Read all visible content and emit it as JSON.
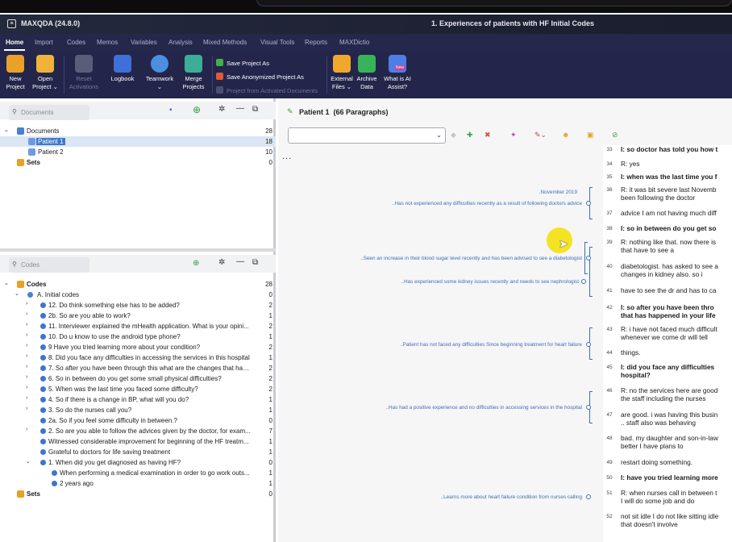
{
  "window": {
    "app_title": "MAXQDA (24.8.0)",
    "doc_title": "1. Experiences of patients with HF Initial Codes"
  },
  "menu": [
    "Home",
    "Import",
    "Codes",
    "Memos",
    "Variables",
    "Analysis",
    "Mixed Methods",
    "Visual Tools",
    "Reports",
    "MAXDictio"
  ],
  "ribbon": {
    "new_project": [
      "New",
      "Project"
    ],
    "open_project": [
      "Open",
      "Project ⌄"
    ],
    "reset_activations": [
      "Reset",
      "Activations"
    ],
    "logbook": "Logbook",
    "teamwork": [
      "Teamwork",
      "⌄"
    ],
    "merge_projects": [
      "Merge",
      "Projects"
    ],
    "save_project_as": "Save Project As",
    "save_anonymized": "Save Anonymized Project As",
    "project_from_activated": "Project from Activated Documents",
    "external_files": [
      "External",
      "Files ⌄"
    ],
    "archive_data": [
      "Archive",
      "Data"
    ],
    "ai_assist": [
      "What is AI",
      "Assist?"
    ],
    "ai_badge": "New"
  },
  "documents": {
    "search_placeholder": "Documents",
    "root": {
      "label": "Documents",
      "count": "28"
    },
    "items": [
      {
        "label": "Patient 1",
        "count": "18"
      },
      {
        "label": "Patient 2",
        "count": "10"
      }
    ],
    "sets": {
      "label": "Sets",
      "count": "0"
    }
  },
  "codes": {
    "search_placeholder": "Codes",
    "root": {
      "label": "Codes",
      "count": "28"
    },
    "items": [
      {
        "label": "A. Initial codes",
        "count": "0",
        "level": 1,
        "chev": "⌄"
      },
      {
        "label": "12. Do think something else has to be added?",
        "count": "2",
        "level": 2,
        "chev": "›"
      },
      {
        "label": "2b. So are you able to work?",
        "count": "1",
        "level": 2,
        "chev": "›"
      },
      {
        "label": "11. Interviewer explained the mHealth application.  What is your opini...",
        "count": "2",
        "level": 2,
        "chev": "›"
      },
      {
        "label": "10. Do u know to use the android type phone?",
        "count": "1",
        "level": 2,
        "chev": "›"
      },
      {
        "label": "9 Have you tried learning more about your condition?",
        "count": "2",
        "level": 2,
        "chev": "›"
      },
      {
        "label": "8. Did you face any difficulties in accessing the services in this hospital",
        "count": "1",
        "level": 2,
        "chev": "›"
      },
      {
        "label": "7. So after you have been through this what are the changes that has ...",
        "count": "2",
        "level": 2,
        "chev": "›"
      },
      {
        "label": "6. So in between do you get some small physical difficulties?",
        "count": "2",
        "level": 2,
        "chev": "›"
      },
      {
        "label": "5.  When was the last time you faced some difficulty?",
        "count": "2",
        "level": 2,
        "chev": "›"
      },
      {
        "label": "4. So if there is a change in BP, what will you do?",
        "count": "1",
        "level": 2,
        "chev": "›"
      },
      {
        "label": "3. So do the nurses call you?",
        "count": "1",
        "level": 2,
        "chev": "›"
      },
      {
        "label": "2a. So if you feel some difficulty in between.?",
        "count": "0",
        "level": 2,
        "chev": ""
      },
      {
        "label": "2. So are you able to follow the advices given by the doctor, for exam...",
        "count": "7",
        "level": 2,
        "chev": "›"
      },
      {
        "label": "Witnessed considerable improvement for beginning of the HF treatm...",
        "count": "1",
        "level": 2,
        "chev": ""
      },
      {
        "label": "Grateful to doctors for life saving treatment",
        "count": "1",
        "level": 2,
        "chev": ""
      },
      {
        "label": "1. When did you get diagnosed as having HF?",
        "count": "0",
        "level": 2,
        "chev": "⌄"
      },
      {
        "label": "When performing a medical examination in order to go work outs...",
        "count": "1",
        "level": 3,
        "chev": ""
      },
      {
        "label": "2 years ago",
        "count": "1",
        "level": 3,
        "chev": ""
      }
    ],
    "sets": {
      "label": "Sets",
      "count": "0"
    }
  },
  "browser": {
    "title": "Patient 1",
    "paragraph_count": "(66 Paragraphs)",
    "more": "...",
    "memos": [
      ".November 2019",
      "..Has not experienced any difficulties recently as a result of following doctors advice",
      "..Seen an increase in their blood sugar level recently and has been advised to see a diabetologist",
      "..Has experienced some kidney issues recently and needs to see nephrologist",
      "..Patient has not faced any difficulties Since beginning treatment for heart failure",
      "..Has had a positive experience and no difficulties in accessing services in the hospital",
      "..Learns more about heart failure condition from nurses calling"
    ],
    "paragraphs": [
      {
        "n": "33",
        "text": "I: so doctor has told you how t",
        "bold": true
      },
      {
        "n": "34",
        "text": "R: yes",
        "bold": false
      },
      {
        "n": "35",
        "text": "I: when was the last time you f",
        "bold": true
      },
      {
        "n": "36",
        "text": "R: it was bit severe last Novemb",
        "text2": "been following the doctor",
        "bold": false
      },
      {
        "n": "37",
        "text": "advice I am not having much diff",
        "bold": false
      },
      {
        "n": "38",
        "text": "I: so in between do you get so",
        "bold": true
      },
      {
        "n": "39",
        "text": "R: nothing like that. now there is",
        "text2": "that have to see a",
        "bold": false
      },
      {
        "n": "40",
        "text": "diabetologist. has asked to see a",
        "text2": "changes in kidney also. so i",
        "bold": false
      },
      {
        "n": "41",
        "text": "have to see the dr and has to ca",
        "bold": false
      },
      {
        "n": "42",
        "text": "I: so after you have been thro",
        "text2": "that has happened in your life",
        "bold": true
      },
      {
        "n": "43",
        "text": "R: i have not faced much difficult",
        "text2": "whenever we come dr will tell",
        "bold": false
      },
      {
        "n": "44",
        "text": "things.",
        "bold": false
      },
      {
        "n": "45",
        "text": "I: did you face any difficulties",
        "text2": "hospital?",
        "bold": true
      },
      {
        "n": "46",
        "text": "R: no the services here are good",
        "text2": "the staff including the nurses",
        "bold": false
      },
      {
        "n": "47",
        "text": "are good. i was having this busin",
        "text2": ".. staff also was behaving",
        "bold": false
      },
      {
        "n": "48",
        "text": "bad. my daughter and son-in-law",
        "text2": "better I have plans to",
        "bold": false
      },
      {
        "n": "49",
        "text": "restart doing something.",
        "bold": false
      },
      {
        "n": "50",
        "text": "I: have you tried learning more",
        "bold": true
      },
      {
        "n": "51",
        "text": "R: when nurses call in between t",
        "text2": "I will do some job and do",
        "bold": false
      },
      {
        "n": "52",
        "text": "not sit idle I do not like sitting idle",
        "text2": "that doesn't involve",
        "bold": false
      }
    ]
  },
  "colors": {
    "accent": "#3f78c9",
    "memo_blue": "#3b6fb6",
    "ribbon_bg": "#23264a",
    "highlight": "#f4e10a"
  }
}
